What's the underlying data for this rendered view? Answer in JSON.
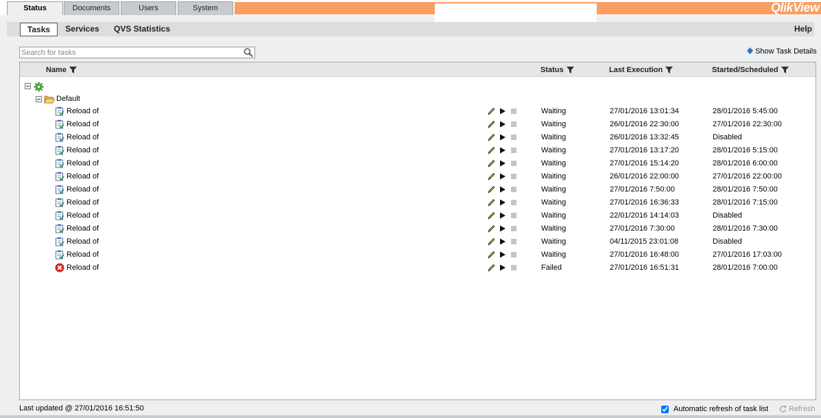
{
  "top_tabs": [
    {
      "label": "Status",
      "active": true
    },
    {
      "label": "Documents",
      "active": false
    },
    {
      "label": "Users",
      "active": false
    },
    {
      "label": "System",
      "active": false
    }
  ],
  "logo": "QlikView",
  "sub_tabs": [
    {
      "label": "Tasks",
      "active": true
    },
    {
      "label": "Services",
      "active": false
    },
    {
      "label": "QVS Statistics",
      "active": false
    }
  ],
  "help_label": "Help",
  "search": {
    "placeholder": "Search for tasks",
    "value": ""
  },
  "show_task_details": "Show Task Details",
  "columns": {
    "name": "Name",
    "status": "Status",
    "last_execution": "Last Execution",
    "started_scheduled": "Started/Scheduled"
  },
  "tree": {
    "root_icon": "gear-icon",
    "folder_label": "Default"
  },
  "tasks": [
    {
      "name": "Reload of",
      "icon": "task-icon",
      "status": "Waiting",
      "last_execution": "27/01/2016 13:01:34",
      "scheduled": "28/01/2016 5:45:00"
    },
    {
      "name": "Reload of",
      "icon": "task-icon",
      "status": "Waiting",
      "last_execution": "26/01/2016 22:30:00",
      "scheduled": "27/01/2016 22:30:00"
    },
    {
      "name": "Reload of",
      "icon": "task-icon",
      "status": "Waiting",
      "last_execution": "26/01/2016 13:32:45",
      "scheduled": "Disabled"
    },
    {
      "name": "Reload of",
      "icon": "task-icon",
      "status": "Waiting",
      "last_execution": "27/01/2016 13:17:20",
      "scheduled": "28/01/2016 5:15:00"
    },
    {
      "name": "Reload of",
      "icon": "task-icon",
      "status": "Waiting",
      "last_execution": "27/01/2016 15:14:20",
      "scheduled": "28/01/2016 6:00:00"
    },
    {
      "name": "Reload of",
      "icon": "task-icon",
      "status": "Waiting",
      "last_execution": "26/01/2016 22:00:00",
      "scheduled": "27/01/2016 22:00:00"
    },
    {
      "name": "Reload of",
      "icon": "task-icon",
      "status": "Waiting",
      "last_execution": "27/01/2016 7:50:00",
      "scheduled": "28/01/2016 7:50:00"
    },
    {
      "name": "Reload of",
      "icon": "task-icon",
      "status": "Waiting",
      "last_execution": "27/01/2016 16:36:33",
      "scheduled": "28/01/2016 7:15:00"
    },
    {
      "name": "Reload of",
      "icon": "task-icon",
      "status": "Waiting",
      "last_execution": "22/01/2016 14:14:03",
      "scheduled": "Disabled"
    },
    {
      "name": "Reload of",
      "icon": "task-icon",
      "status": "Waiting",
      "last_execution": "27/01/2016 7:30:00",
      "scheduled": "28/01/2016 7:30:00"
    },
    {
      "name": "Reload of",
      "icon": "task-icon",
      "status": "Waiting",
      "last_execution": "04/11/2015 23:01:08",
      "scheduled": "Disabled"
    },
    {
      "name": "Reload of",
      "icon": "task-icon",
      "status": "Waiting",
      "last_execution": "27/01/2016 16:48:00",
      "scheduled": "27/01/2016 17:03:00"
    },
    {
      "name": "Reload of",
      "icon": "failed-icon",
      "status": "Failed",
      "last_execution": "27/01/2016 16:51:31",
      "scheduled": "28/01/2016 7:00:00"
    }
  ],
  "footer": {
    "last_updated": "Last updated @ 27/01/2016 16:51:50",
    "auto_refresh_label": "Automatic refresh of task list",
    "auto_refresh_checked": true,
    "refresh_label": "Refresh"
  },
  "colors": {
    "accent_orange": "#fb9e64",
    "failed_red": "#d9261c",
    "task_green": "#3c9b2e"
  }
}
